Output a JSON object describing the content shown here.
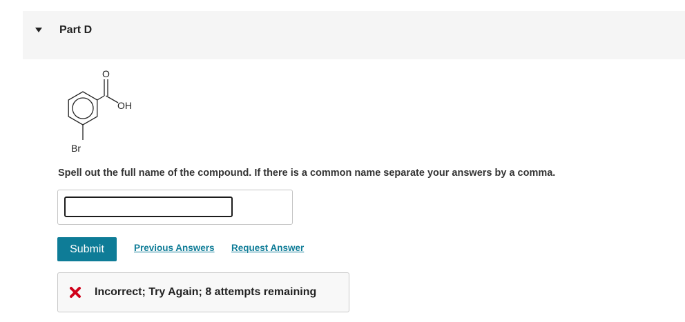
{
  "part": {
    "title": "Part D",
    "expanded": true
  },
  "structure": {
    "atoms": {
      "oxygen": "O",
      "hydroxyl": "OH",
      "bromine": "Br"
    }
  },
  "question": {
    "prompt": "Spell out the full name of the compound. If there is a common name separate your answers by a comma."
  },
  "answer": {
    "value": "",
    "placeholder": ""
  },
  "actions": {
    "submit_label": "Submit",
    "previous_answers_label": "Previous Answers",
    "request_answer_label": "Request Answer"
  },
  "feedback": {
    "icon": "x-icon",
    "message": "Incorrect; Try Again; 8 attempts remaining",
    "color": "#d0021b"
  },
  "colors": {
    "accent": "#0e7c97",
    "header_bg": "#f5f5f5"
  }
}
